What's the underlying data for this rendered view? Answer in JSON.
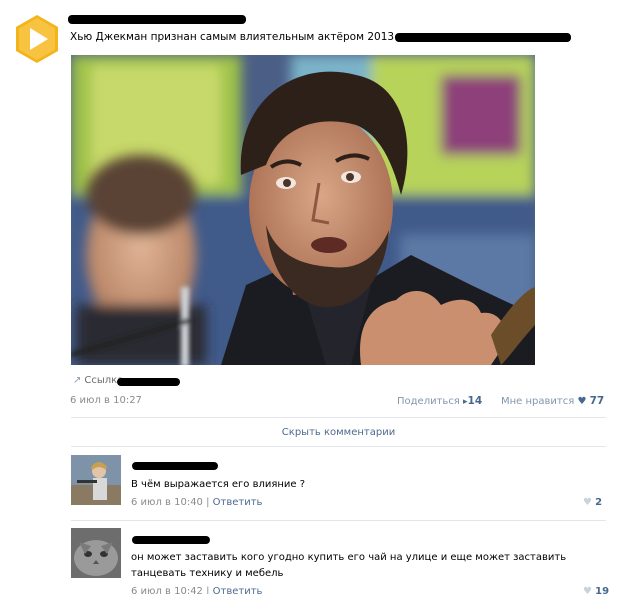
{
  "post": {
    "text": "Хью Джекман признан самым влиятельным актёром 2013 года:",
    "link_label": "Ссылка",
    "date": "6 июл в 10:27",
    "share_label": "Поделиться",
    "share_count": "14",
    "like_label": "Мне нравится",
    "like_count": "77",
    "hide_comments": "Скрыть комментарии"
  },
  "comments": [
    {
      "text": "В чём выражается его влияние ?",
      "time": "6 июл в 10:40",
      "reply": "Ответить",
      "likes": "2"
    },
    {
      "text": "он может заставить кого угодно купить его чай на улице и еще может заставить танцевать технику и мебель",
      "time": "6 июл в 10:42",
      "reply": "Ответить",
      "likes": "19"
    }
  ],
  "icons": {
    "group_avatar": "play-icon",
    "link": "link-arrow-icon",
    "share": "megaphone-icon",
    "like": "heart-icon"
  },
  "colors": {
    "link": "#45688e",
    "avatar_bg": "#f3b41b",
    "muted": "#8b8b8b"
  }
}
